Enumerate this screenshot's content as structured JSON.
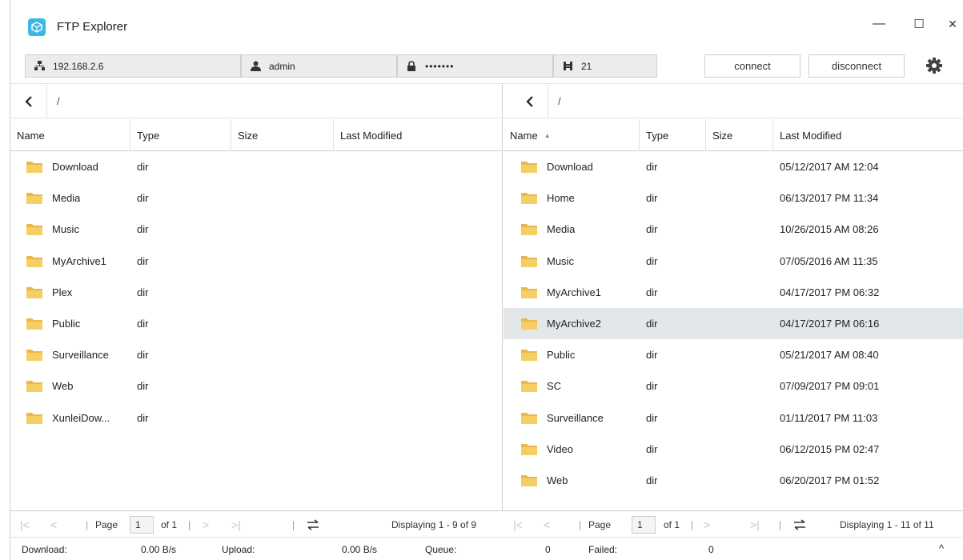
{
  "window": {
    "title": "FTP Explorer",
    "minimize": "—",
    "maximize": "☐",
    "close": "✕"
  },
  "connection": {
    "host": "192.168.2.6",
    "user": "admin",
    "password": "•••••••",
    "port": "21",
    "connect_label": "connect",
    "disconnect_label": "disconnect"
  },
  "left_pane": {
    "path": "/",
    "columns": [
      "Name",
      "Type",
      "Size",
      "Last Modified"
    ],
    "rows": [
      {
        "name": "Download",
        "type": "dir",
        "size": "",
        "modified": ""
      },
      {
        "name": "Media",
        "type": "dir",
        "size": "",
        "modified": ""
      },
      {
        "name": "Music",
        "type": "dir",
        "size": "",
        "modified": ""
      },
      {
        "name": "MyArchive1",
        "type": "dir",
        "size": "",
        "modified": ""
      },
      {
        "name": "Plex",
        "type": "dir",
        "size": "",
        "modified": ""
      },
      {
        "name": "Public",
        "type": "dir",
        "size": "",
        "modified": ""
      },
      {
        "name": "Surveillance",
        "type": "dir",
        "size": "",
        "modified": ""
      },
      {
        "name": "Web",
        "type": "dir",
        "size": "",
        "modified": ""
      },
      {
        "name": "XunleiDow...",
        "type": "dir",
        "size": "",
        "modified": ""
      }
    ],
    "pager": {
      "page_label": "Page",
      "page": "1",
      "of": "of 1",
      "display": "Displaying 1 - 9 of 9"
    }
  },
  "right_pane": {
    "path": "/",
    "columns": [
      "Name",
      "Type",
      "Size",
      "Last Modified"
    ],
    "sort_indicator": "▲",
    "rows": [
      {
        "name": "Download",
        "type": "dir",
        "size": "",
        "modified": "05/12/2017 AM 12:04"
      },
      {
        "name": "Home",
        "type": "dir",
        "size": "",
        "modified": "06/13/2017 PM 11:34"
      },
      {
        "name": "Media",
        "type": "dir",
        "size": "",
        "modified": "10/26/2015 AM 08:26"
      },
      {
        "name": "Music",
        "type": "dir",
        "size": "",
        "modified": "07/05/2016 AM 11:35"
      },
      {
        "name": "MyArchive1",
        "type": "dir",
        "size": "",
        "modified": "04/17/2017 PM 06:32"
      },
      {
        "name": "MyArchive2",
        "type": "dir",
        "size": "",
        "modified": "04/17/2017 PM 06:16",
        "selected": true
      },
      {
        "name": "Public",
        "type": "dir",
        "size": "",
        "modified": "05/21/2017 AM 08:40"
      },
      {
        "name": "SC",
        "type": "dir",
        "size": "",
        "modified": "07/09/2017 PM 09:01"
      },
      {
        "name": "Surveillance",
        "type": "dir",
        "size": "",
        "modified": "01/11/2017 PM 11:03"
      },
      {
        "name": "Video",
        "type": "dir",
        "size": "",
        "modified": "06/12/2015 PM 02:47"
      },
      {
        "name": "Web",
        "type": "dir",
        "size": "",
        "modified": "06/20/2017 PM 01:52"
      }
    ],
    "pager": {
      "page_label": "Page",
      "page": "1",
      "of": "of 1",
      "display": "Displaying 1 - 11 of 11"
    }
  },
  "status": {
    "download_label": "Download:",
    "download_value": "0.00 B/s",
    "upload_label": "Upload:",
    "upload_value": "0.00 B/s",
    "queue_label": "Queue:",
    "queue_value": "0",
    "failed_label": "Failed:",
    "failed_value": "0",
    "expand": "^"
  },
  "colors": {
    "folder": "#f5cf63",
    "app_icon": "#3cb8e6",
    "selected_row": "#e3e7ea"
  },
  "icons": [
    "app-icon",
    "network-icon",
    "user-icon",
    "lock-icon",
    "port-icon",
    "gear-icon",
    "back-arrow-icon",
    "folder-icon",
    "swap-icon"
  ]
}
